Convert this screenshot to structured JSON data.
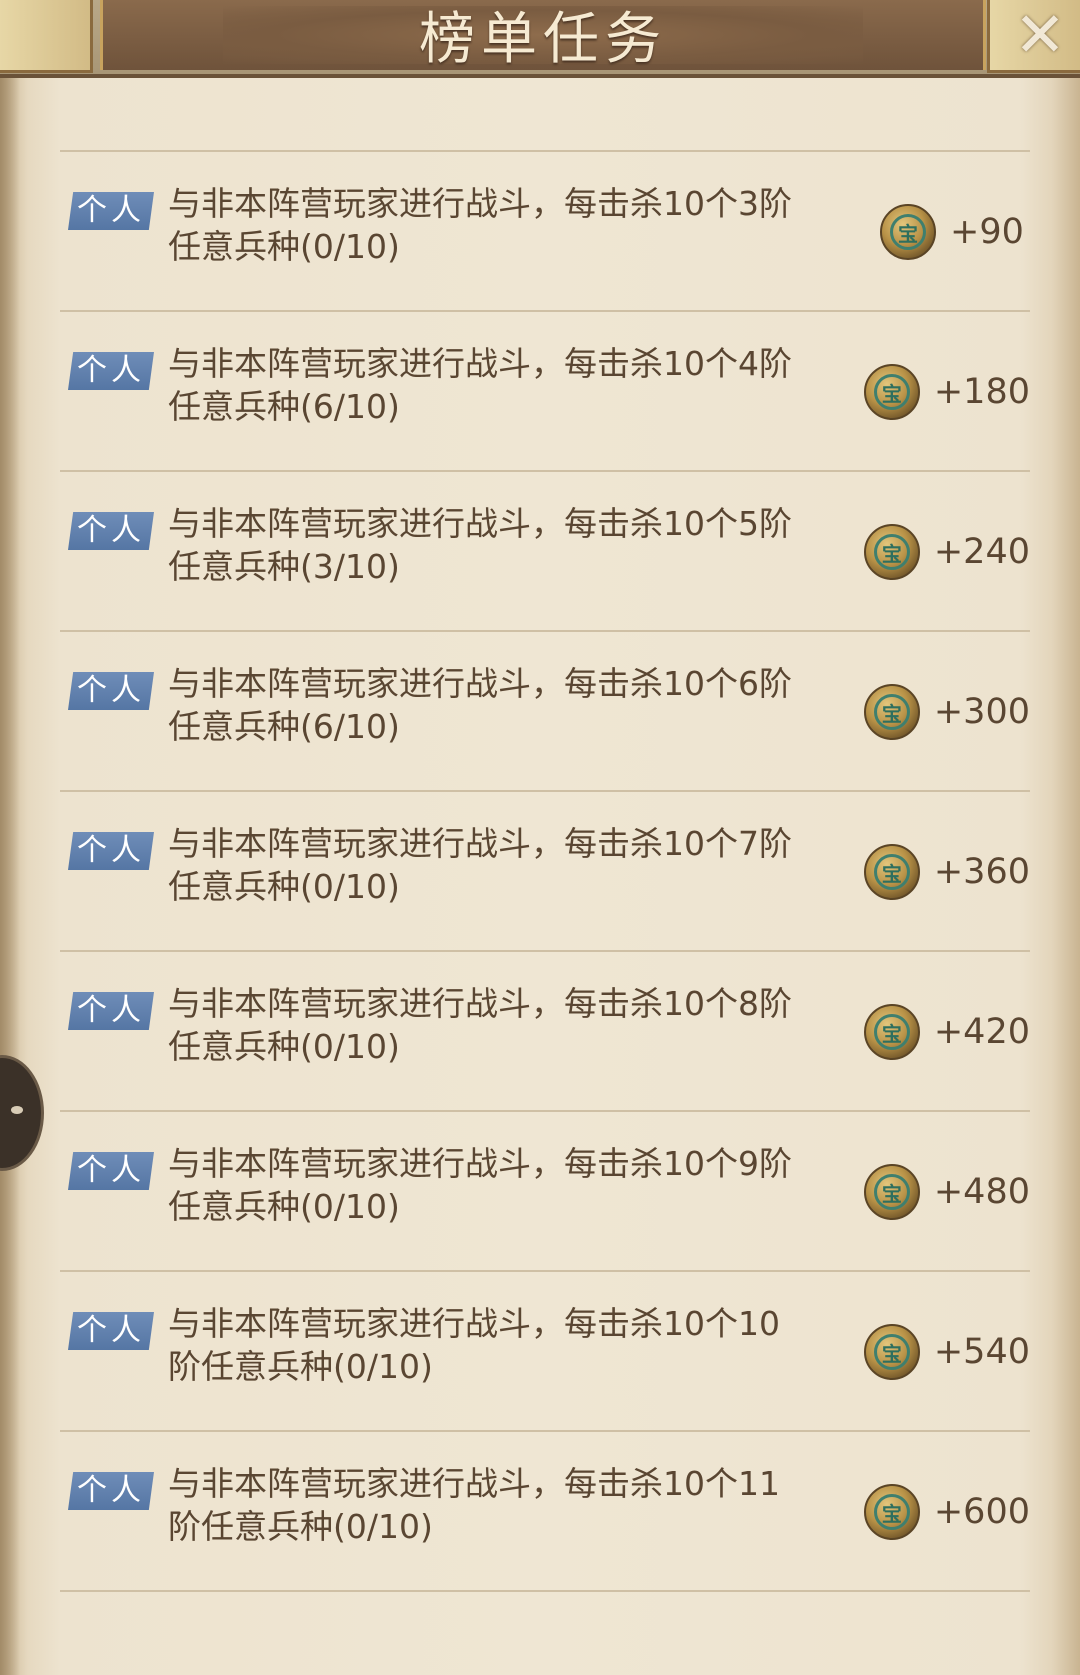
{
  "header": {
    "title": "榜单任务"
  },
  "faded_top_text": "",
  "tasks": [
    {
      "tag": "个人",
      "description": "与非本阵营玩家进行战斗，每击杀10个3阶任意兵种(0/10)",
      "reward": "+90"
    },
    {
      "tag": "个人",
      "description": "与非本阵营玩家进行战斗，每击杀10个4阶任意兵种(6/10)",
      "reward": "+180"
    },
    {
      "tag": "个人",
      "description": "与非本阵营玩家进行战斗，每击杀10个5阶任意兵种(3/10)",
      "reward": "+240"
    },
    {
      "tag": "个人",
      "description": "与非本阵营玩家进行战斗，每击杀10个6阶任意兵种(6/10)",
      "reward": "+300"
    },
    {
      "tag": "个人",
      "description": "与非本阵营玩家进行战斗，每击杀10个7阶任意兵种(0/10)",
      "reward": "+360"
    },
    {
      "tag": "个人",
      "description": "与非本阵营玩家进行战斗，每击杀10个8阶任意兵种(0/10)",
      "reward": "+420"
    },
    {
      "tag": "个人",
      "description": "与非本阵营玩家进行战斗，每击杀10个9阶任意兵种(0/10)",
      "reward": "+480"
    },
    {
      "tag": "个人",
      "description": "与非本阵营玩家进行战斗，每击杀10个10阶任意兵种(0/10)",
      "reward": "+540"
    },
    {
      "tag": "个人",
      "description": "与非本阵营玩家进行战斗，每击杀10个11阶任意兵种(0/10)",
      "reward": "+600"
    }
  ],
  "icons": {
    "reward": "coin-icon",
    "close": "close-icon"
  },
  "colors": {
    "tag_bg": "#5f7fae",
    "text": "#5a4632",
    "banner": "#7a5c41",
    "paper": "#efe6d3"
  }
}
